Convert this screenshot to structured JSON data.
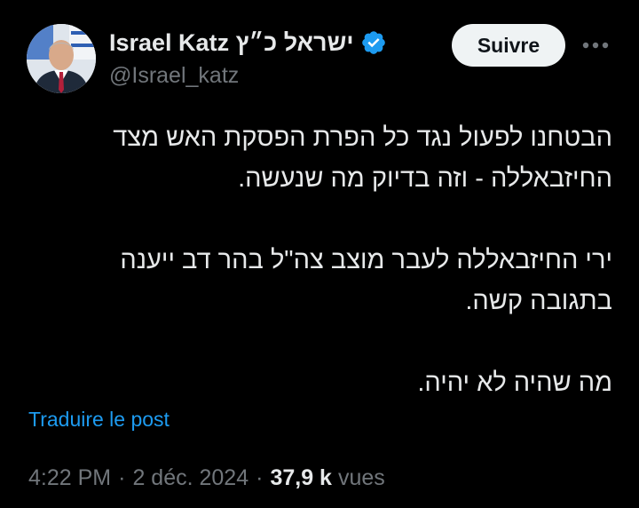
{
  "author": {
    "display_name": "ישראל כ״ץ Israel Katz",
    "handle": "@Israel_katz",
    "verified": true,
    "avatar_icon": "profile-photo-avatar"
  },
  "actions": {
    "follow_label": "Suivre",
    "more_icon": "more-horizontal-icon"
  },
  "tweet": {
    "lines": [
      "הבטחנו לפעול נגד כל הפרת הפסקת האש מצד",
      "החיזבאללה - וזה בדיוק מה שנעשה.",
      "",
      "ירי החיזבאללה לעבר מוצב צה\"ל בהר דב ייענה",
      "בתגובה קשה.",
      "",
      "מה שהיה לא יהיה."
    ]
  },
  "translate_label": "Traduire le post",
  "meta": {
    "time": "4:22 PM",
    "date": "2 déc. 2024",
    "separator": "·",
    "views_count": "37,9 k",
    "views_label": "vues"
  },
  "colors": {
    "background": "#000000",
    "text_primary": "#e7e9ea",
    "text_secondary": "#71767b",
    "link_blue": "#1d9bf0",
    "verified_blue": "#1d9bf0",
    "button_bg": "#eff3f4"
  }
}
